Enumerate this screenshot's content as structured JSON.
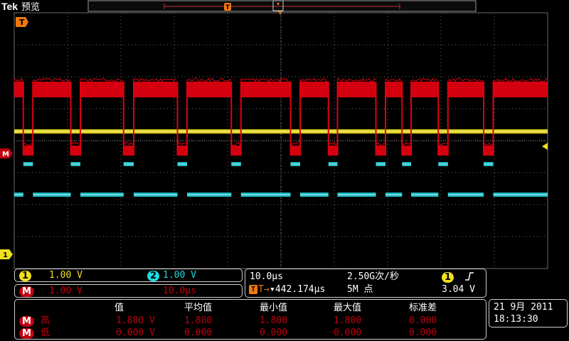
{
  "header": {
    "brand": "Tek",
    "mode": "预览"
  },
  "markers": {
    "trigger_position": "T",
    "trigger_top": "T",
    "math": "M",
    "ch1": "1"
  },
  "colors": {
    "ch1": "#f0e020",
    "ch2": "#20d8e0",
    "math": "#e00010",
    "math_dark": "#c00010",
    "grid": "#6a6a6a",
    "panel_border": "#cfcfcf"
  },
  "channels": {
    "ch1": {
      "badge": "1",
      "scale": "1.00 V"
    },
    "ch2": {
      "badge": "2",
      "scale": "1.00 V"
    },
    "math": {
      "badge": "M",
      "scale": "1.00 V",
      "timebase": "10.0µs"
    }
  },
  "timebase": {
    "horizontal_scale": "10.0µs",
    "sample_rate": "2.50G次/秒",
    "trigger_prefix": "T→",
    "trigger_delay": "▾442.174µs",
    "record_length": "5M 点",
    "trigger_source": "1",
    "trigger_slope": "rising-edge-icon",
    "trigger_level": "3.04 V"
  },
  "measurements": {
    "headers": [
      "值",
      "平均值",
      "最小值",
      "最大值",
      "标准差"
    ],
    "rows": [
      {
        "source": "M",
        "name": "高",
        "value": "1.800 V",
        "mean": "1.800",
        "min": "1.800",
        "max": "1.800",
        "std": "0.000"
      },
      {
        "source": "M",
        "name": "低",
        "value": "0.000 V",
        "mean": "0.000",
        "min": "0.000",
        "max": "0.000",
        "std": "0.000"
      }
    ]
  },
  "datetime": {
    "date": "21 9月  2011",
    "time": "18:13:30"
  },
  "chart_data": {
    "type": "line",
    "x_unit": "µs",
    "y_unit": "div",
    "xlim": [
      -50,
      50
    ],
    "ylim": [
      -4,
      4
    ],
    "grid": true,
    "series": [
      {
        "name": "M",
        "high": 1.8,
        "low": 0.0,
        "edges": [
          -48.3,
          -46.5,
          -39.4,
          -37.6,
          -29.5,
          -27.6,
          -19.4,
          -17.6,
          -9.3,
          -7.5,
          1.8,
          3.6,
          8.9,
          10.6,
          17.8,
          19.6,
          22.7,
          24.4,
          29.5,
          31.3,
          38.0,
          39.8
        ],
        "start_level": "high"
      },
      {
        "name": "1",
        "values": "constant",
        "level": 1.0
      },
      {
        "name": "2",
        "low": -2.0,
        "step": -0.5
      }
    ]
  }
}
